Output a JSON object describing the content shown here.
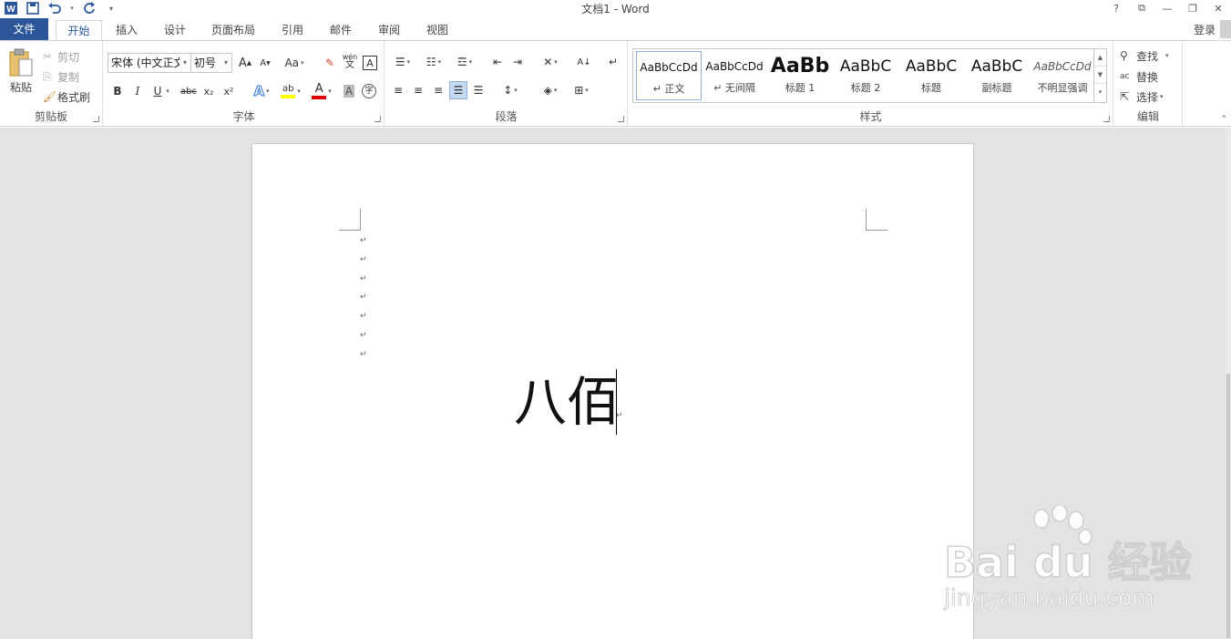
{
  "window": {
    "title": "文档1 - Word",
    "controls": [
      "?",
      "⧉",
      "—",
      "❐",
      "✕"
    ]
  },
  "tabs": {
    "file": "文件",
    "items": [
      "开始",
      "插入",
      "设计",
      "页面布局",
      "引用",
      "邮件",
      "审阅",
      "视图"
    ],
    "login": "登录"
  },
  "clipboard": {
    "paste": "粘贴",
    "cut": "剪切",
    "copy": "复制",
    "format_painter": "格式刷",
    "label": "剪贴板"
  },
  "font": {
    "name": "宋体 (中文正文)",
    "size": "初号",
    "label": "字体",
    "wen_top": "wén",
    "wen_bottom": "文",
    "bold": "B",
    "italic": "I",
    "underline": "U",
    "strike": "abc",
    "sub": "x₂",
    "sup": "x²",
    "aa": "Aa",
    "grow": "A",
    "shrink": "A",
    "color_a": "A",
    "shade_a": "A",
    "enclose": "字",
    "highlight_color": "#ffff00",
    "font_color": "#e00000"
  },
  "paragraph": {
    "label": "段落"
  },
  "styles": {
    "label": "样式",
    "items": [
      {
        "preview": "AaBbCcDd",
        "name": "↵ 正文"
      },
      {
        "preview": "AaBbCcDd",
        "name": "↵ 无间隔"
      },
      {
        "preview": "AaBb",
        "name": "标题 1"
      },
      {
        "preview": "AaBbC",
        "name": "标题 2"
      },
      {
        "preview": "AaBbC",
        "name": "标题"
      },
      {
        "preview": "AaBbC",
        "name": "副标题"
      },
      {
        "preview": "AaBbCcDd",
        "name": "不明显强调"
      }
    ]
  },
  "editing": {
    "find": "查找",
    "replace": "替换",
    "select": "选择",
    "label": "编辑"
  },
  "document": {
    "paragraph_mark": "↵",
    "empty_paragraph_marks": [
      "↵",
      "↵",
      "↵",
      "↵",
      "↵",
      "↵",
      "↵"
    ],
    "text": "八佰"
  },
  "watermark": {
    "brand": "Bai du 经验",
    "url": "jingyan.baidu.com"
  },
  "colors": {
    "accent": "#2b579a",
    "doc_background": "#e3e3e3"
  }
}
